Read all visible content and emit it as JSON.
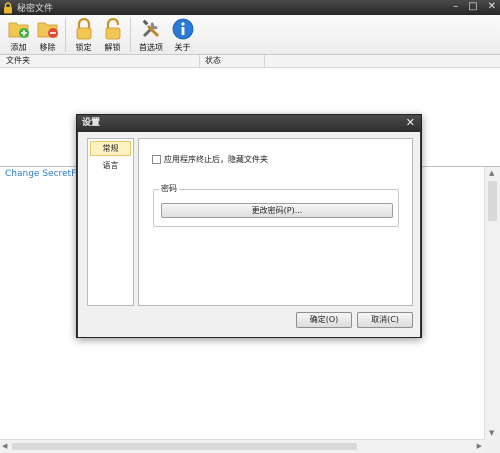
{
  "window": {
    "title": "秘密文件"
  },
  "toolbar": {
    "add_label": "添加",
    "remove_label": "移除",
    "lock_label": "锁定",
    "unlock_label": "解锁",
    "prefs_label": "首选项",
    "about_label": "关于"
  },
  "columns": {
    "folder": "文件夹",
    "status": "状态"
  },
  "log": {
    "text": "Change SecretFo"
  },
  "dialog": {
    "title": "设置",
    "nav": {
      "general": "常规",
      "language": "语言"
    },
    "hide_on_exit_label": "应用程序终止后，隐藏文件夹",
    "password_group_label": "密码",
    "change_password_button": "更改密码(P)...",
    "ok_button": "确定(O)",
    "cancel_button": "取消(C)"
  },
  "colors": {
    "titlebar": "#2e2e2e",
    "accent_link": "#2a7fd0",
    "nav_selected": "#fff2c2"
  }
}
